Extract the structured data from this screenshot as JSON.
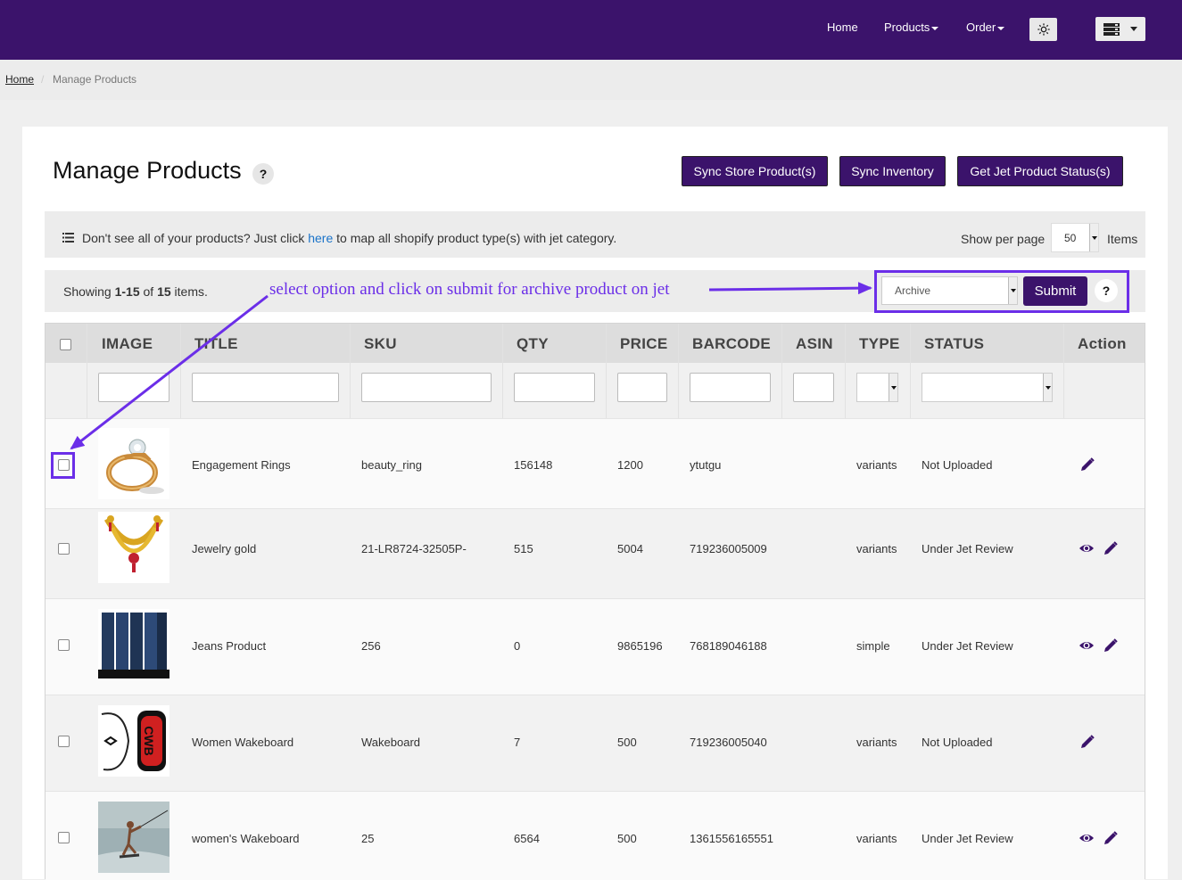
{
  "nav": {
    "home": "Home",
    "products": "Products",
    "order": "Order"
  },
  "breadcrumb": {
    "home": "Home",
    "separator": "/",
    "current": "Manage Products"
  },
  "page": {
    "title": "Manage Products",
    "help": "?"
  },
  "buttons": {
    "sync_store": "Sync Store Product(s)",
    "sync_inventory": "Sync Inventory",
    "get_status": "Get Jet Product Status(s)"
  },
  "info": {
    "text_before": "Don't see all of your products? Just click ",
    "link": "here",
    "text_after": " to map all shopify product type(s) with jet category.",
    "per_page_label": "Show per page",
    "per_page_value": "50",
    "items_label": "Items"
  },
  "summary": {
    "prefix": "Showing ",
    "range": "1-15",
    "middle": " of ",
    "total": "15",
    "suffix": " items."
  },
  "annotation": "select option and click on submit for archive product on jet",
  "bulk": {
    "action_value": "Archive",
    "submit": "Submit",
    "help": "?"
  },
  "columns": [
    "IMAGE",
    "TITLE",
    "SKU",
    "QTY",
    "PRICE",
    "BARCODE",
    "ASIN",
    "TYPE",
    "STATUS",
    "Action"
  ],
  "rows": [
    {
      "image": "ring-image",
      "title": "Engagement Rings",
      "sku": "beauty_ring",
      "qty": "156148",
      "price": "1200",
      "barcode": "ytutgu",
      "asin": "",
      "type": "variants",
      "status": "Not Uploaded",
      "actions": [
        "edit"
      ]
    },
    {
      "image": "necklace-image",
      "title": "Jewelry gold",
      "sku": "21-LR8724-32505P-",
      "qty": "515",
      "price": "5004",
      "barcode": "719236005009",
      "asin": "",
      "type": "variants",
      "status": "Under Jet Review",
      "actions": [
        "view",
        "edit"
      ]
    },
    {
      "image": "jeans-image",
      "title": "Jeans Product",
      "sku": "256",
      "qty": "0",
      "price": "9865196",
      "barcode": "768189046188",
      "asin": "",
      "type": "simple",
      "status": "Under Jet Review",
      "actions": [
        "view",
        "edit"
      ]
    },
    {
      "image": "wakeboard-image",
      "title": "Women Wakeboard",
      "sku": "Wakeboard",
      "qty": "7",
      "price": "500",
      "barcode": "719236005040",
      "asin": "",
      "type": "variants",
      "status": "Not Uploaded",
      "actions": [
        "edit"
      ]
    },
    {
      "image": "wakeboarder-photo",
      "title": "women's Wakeboard",
      "sku": "25",
      "qty": "6564",
      "price": "500",
      "barcode": "1361556165551",
      "asin": "",
      "type": "variants",
      "status": "Under Jet Review",
      "actions": [
        "view",
        "edit"
      ]
    }
  ],
  "colors": {
    "brand": "#3b136b",
    "annotation": "#6b2ee8",
    "link": "#1a73c9"
  },
  "icons": {
    "settings": "gear-icon",
    "menu": "server-menu-icon",
    "list": "list-icon",
    "view": "eye-icon",
    "edit": "pencil-icon"
  }
}
